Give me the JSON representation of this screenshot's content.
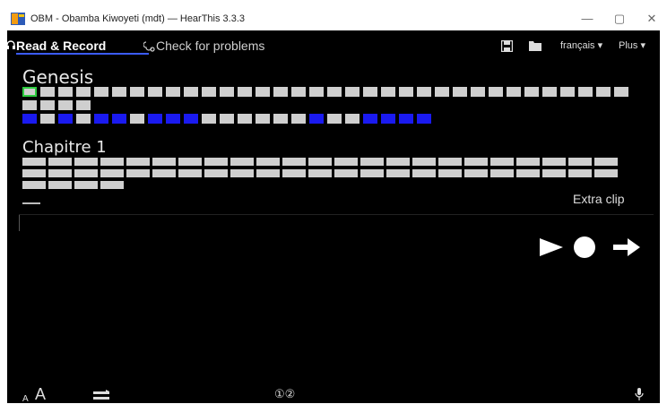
{
  "window": {
    "title": "OBM - Obamba Kiwoyeti (mdt) — HearThis 3.3.3",
    "minimize": "—",
    "maximize": "▢",
    "close": "✕"
  },
  "tabs": {
    "read": "Read & Record",
    "check": "Check for problems"
  },
  "toolbar": {
    "language": "français ▾",
    "more": "Plus ▾"
  },
  "book": {
    "title": "Genesis",
    "chapter_buttons_row1": 34,
    "chapter_buttons_row2": 4,
    "chapter_buttons_row3": 23,
    "row3_selected": [
      0,
      2,
      4,
      5,
      7,
      8,
      9,
      16,
      19,
      20,
      21,
      22,
      23,
      24,
      25,
      26
    ]
  },
  "chapter": {
    "title": "Chapitre 1",
    "verse_row_counts": [
      23,
      23,
      4
    ]
  },
  "recording": {
    "extra_clip": "Extra clip",
    "line": "—"
  },
  "footer": {
    "small_a": "A",
    "big_a": "A",
    "circled_numbers": "①②"
  }
}
